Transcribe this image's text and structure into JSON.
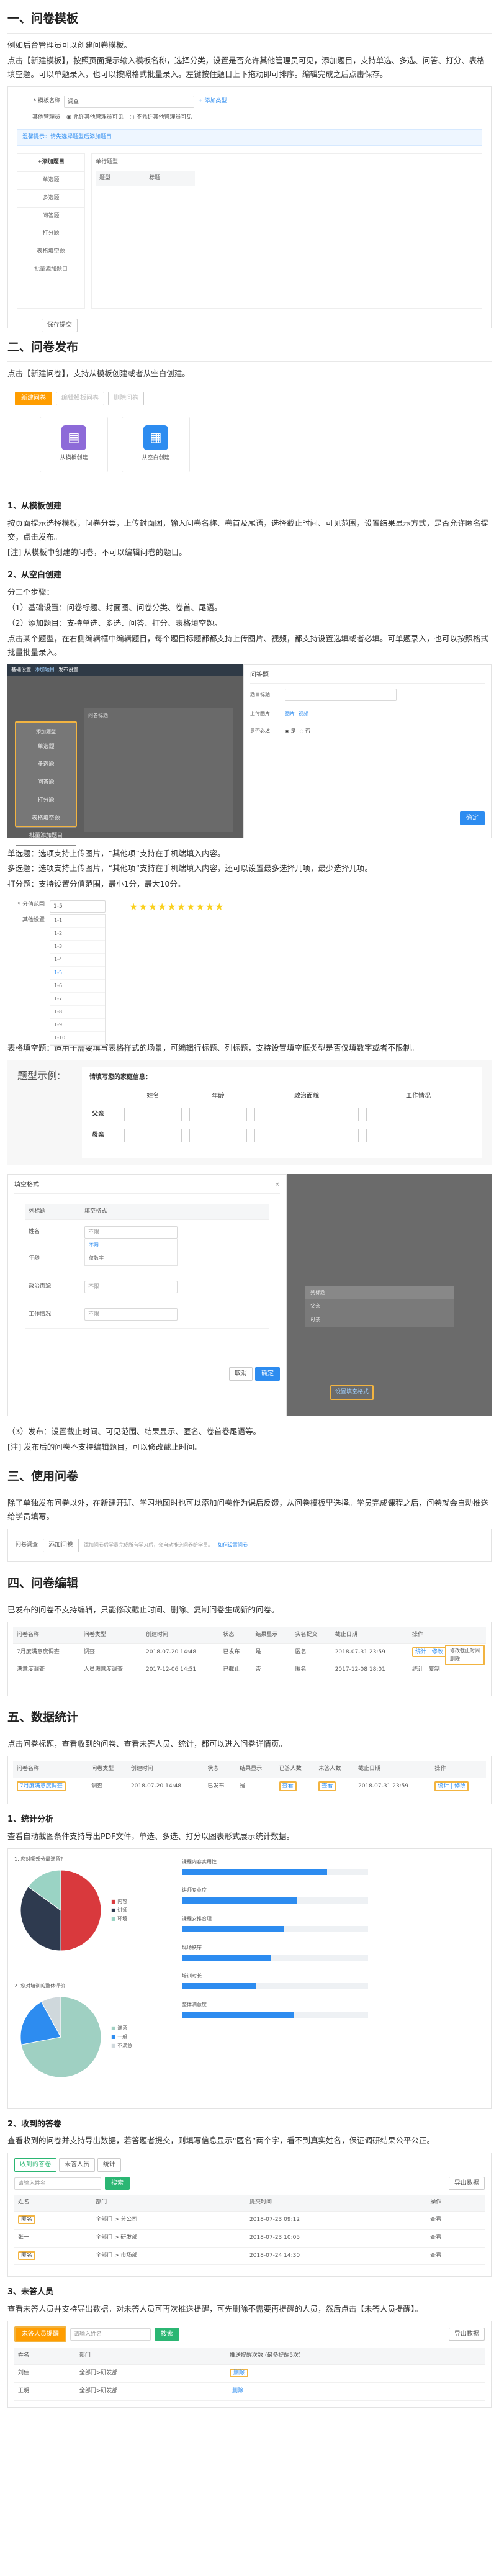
{
  "sec1": {
    "title": "一、问卷模板",
    "intro": "例如后台管理员可以创建问卷模板。",
    "desc": "点击【新建模板】，按照页面提示输入模板名称，选择分类，设置是否允许其他管理员可见，添加题目，支持单选、多选、问答、打分、表格填空题。可以单题录入，也可以按照格式批量录入。左键按住题目上下拖动即可排序。编辑完成之后点击保存。",
    "shot": {
      "name_label": "* 模板名称",
      "name_value": "调查",
      "add_category": "+ 添加类型",
      "visible_label": "其他管理员",
      "opt_allow": "允许其他管理员可见",
      "opt_disallow": "不允许其他管理员可见",
      "tip": "温馨提示：请先选择题型后添加题目",
      "add_question": "+添加题目",
      "question_types": [
        "单选题",
        "多选题",
        "问答题",
        "打分题",
        "表格填空题"
      ],
      "batch_add": "批量添加题目",
      "q_type_label": "单行题型",
      "col_type": "题型",
      "col_title": "标题",
      "save": "保存提交"
    }
  },
  "sec2": {
    "title": "二、问卷发布",
    "desc": "点击【新建问卷】，支持从模板创建或者从空白创建。",
    "shot": {
      "btn_new": "新建问卷",
      "btn_tpl": "编辑模板问卷",
      "btn_del": "删除问卷",
      "card_tpl": "从模板创建",
      "card_blank": "从空白创建"
    },
    "sub1_title": "1、从模板创建",
    "sub1_desc": "按页面提示选择模板，问卷分类，上传封面图，输入问卷名称、卷首及尾语，选择截止时间、可见范围，设置结果显示方式，是否允许匿名提交，点击发布。",
    "sub1_note": "[注] 从模板中创建的问卷，不可以编辑问卷的题目。",
    "sub2_title": "2、从空白创建",
    "sub2_intro": "分三个步骤：",
    "sub2_step1": "（1）基础设置：问卷标题、封面图、问卷分类、卷首、尾语。",
    "sub2_step2": "（2）添加题目：支持单选、多选、问答、打分、表格填空题。",
    "sub2_desc": "点击某个题型，在右侧编辑框中编辑题目，每个题目标题都都支持上传图片、视频，都支持设置选填或者必填。可单题录入，也可以按照格式批量批量录入。",
    "editor": {
      "tab_basic": "基础设置",
      "tab_questions": "添加题目",
      "tab_publish": "发布设置",
      "sidebar_title": "添加题型",
      "types": [
        "单选题",
        "多选题",
        "问答题",
        "打分题",
        "表格填空题",
        "批量添加题目"
      ],
      "q_placeholder": "问卷标题",
      "panel_title": "问答题",
      "field_title": "题目标题",
      "field_upload": "上传图片",
      "field_image": "图片",
      "field_video": "视频",
      "field_required": "是否必填",
      "opt_yes": "是",
      "opt_no": "否",
      "confirm": "确定"
    },
    "single": "单选题：选项支持上传图片，“其他项”支持在手机端填入内容。",
    "multiple": "多选题：选项支持上传图片，“其他项”支持在手机端填入内容，还可以设置最多选择几项，最少选择几项。",
    "score": "打分题：支持设置分值范围，最小1分，最大10分。",
    "score_shot": {
      "range_label": "* 分值范围",
      "range_value": "1-5",
      "max_label": "其他设置",
      "options": [
        "1-1",
        "1-2",
        "1-3",
        "1-4",
        "1-5",
        "1-6",
        "1-7",
        "1-8",
        "1-9",
        "1-10"
      ],
      "stars": "★★★★★★★★★★"
    },
    "table": "表格填空题：适用于需要填写表格样式的场景，可编辑行标题、列标题，支持设置填空框类型是否仅填数字或者不限制。",
    "table_example": {
      "caption": "题型示例:",
      "question": "请填写您的家庭信息：",
      "cols": [
        "姓名",
        "年龄",
        "政治面貌",
        "工作情况"
      ],
      "rows": [
        "父亲",
        "母亲"
      ]
    },
    "fill_dialog": {
      "title": "填空格式",
      "col_head": "列标题",
      "col_fmt": "填空格式",
      "rows": [
        "姓名",
        "年龄",
        "政治面貌",
        "工作情况"
      ],
      "values": [
        "不限",
        "不限",
        "不限",
        "不限"
      ],
      "dd_opts": [
        "不限",
        "仅数字"
      ],
      "cancel": "取消",
      "confirm": "确定",
      "side_cols": [
        "列标题",
        "父亲",
        "母亲"
      ],
      "side_link": "设置填空格式"
    },
    "sub3": "（3）发布：设置截止时间、可见范围、结果显示、匿名、卷首卷尾语等。",
    "sub3_note": "[注] 发布后的问卷不支持编辑题目，可以修改截止时间。"
  },
  "sec3": {
    "title": "三、使用问卷",
    "desc": "除了单独发布问卷以外，在新建开班、学习地图时也可以添加问卷作为课后反馈，从问卷模板里选择。学员完成课程之后，问卷就会自动推送给学员填写。",
    "shot": {
      "label": "问卷调查",
      "btn": "添加问卷",
      "tip": "添加问卷后学员完成所有学习后，会自动推送问卷给学员。",
      "link": "如何设置问卷"
    }
  },
  "sec4": {
    "title": "四、问卷编辑",
    "desc": "已发布的问卷不支持编辑，只能修改截止时间、删除、复制问卷生成新的问卷。",
    "table": {
      "headers": [
        "问卷名称",
        "问卷类型",
        "创建时间",
        "状态",
        "结果显示",
        "实名提交",
        "截止日期",
        "操作"
      ],
      "rows": [
        [
          "7月度满意度调查",
          "调查",
          "2018-07-20 14:48",
          "已发布",
          "是",
          "匿名",
          "2018-07-31 23:59",
          "统计 | 修改 | 复制"
        ],
        [
          "满意度调查",
          "人员满意度调查",
          "2017-12-06 14:51",
          "已截止",
          "否",
          "匿名",
          "2017-12-08 18:01",
          "统计 | 复制"
        ]
      ],
      "popup": [
        "修改截止时间",
        "删除"
      ]
    }
  },
  "sec5": {
    "title": "五、数据统计",
    "desc": "点击问卷标题，查看收到的问卷、查看未答人员、统计，都可以进入问卷详情页。",
    "table": {
      "headers": [
        "问卷名称",
        "问卷类型",
        "创建时间",
        "状态",
        "结果显示",
        "已答人数",
        "未答人数",
        "截止日期",
        "操作"
      ],
      "row": [
        "7月度满意度调查",
        "调查",
        "2018-07-20 14:48",
        "已发布",
        "是",
        "查看",
        "查看",
        "2018-07-31 23:59",
        "统计 | 修改"
      ]
    },
    "sub1_title": "1、统计分析",
    "sub1_desc": "查看自动截图条件支持导出PDF文件，单选、多选、打分以图表形式展示统计数据。",
    "pie1": {
      "label": "1. 您对哪部分最满意？",
      "legend": [
        "内容",
        "讲师",
        "环境"
      ],
      "values": [
        50,
        35,
        15
      ],
      "colors": [
        "#d9393d",
        "#2e3a4f",
        "#9ad3c4"
      ]
    },
    "pie2": {
      "label": "2. 您对培训的整体评价",
      "legend": [
        "满意",
        "一般",
        "不满意"
      ],
      "values": [
        72,
        20,
        8
      ],
      "colors": [
        "#9fd0c2",
        "#2d8cf0",
        "#cfd8dc"
      ]
    },
    "bars1": {
      "items": [
        "课程内容实用性",
        "讲师专业度",
        "课程安排合理",
        "现场秩序",
        "培训时长",
        "整体满意度"
      ],
      "values": [
        0.78,
        0.62,
        0.55,
        0.48,
        0.4,
        0.6
      ]
    },
    "sub2_title": "2、收到的答卷",
    "sub2_desc": "查看收到的问卷并支持导出数据，若答题者提交，则填写信息显示“匿名”两个字，看不到真实姓名，保证调研结果公平公正。",
    "recv": {
      "tabs": [
        "收到的答卷",
        "未答人员",
        "统计"
      ],
      "search_placeholder": "请输入姓名",
      "search_btn": "搜索",
      "export": "导出数据",
      "headers": [
        "姓名",
        "部门",
        "提交时间",
        "操作"
      ],
      "rows": [
        [
          "匿名",
          "全部门 > 分公司",
          "2018-07-23 09:12",
          "查看"
        ],
        [
          "张一",
          "全部门 > 研发部",
          "2018-07-23 10:05",
          "查看"
        ],
        [
          "匿名",
          "全部门 > 市场部",
          "2018-07-24 14:30",
          "查看"
        ]
      ]
    },
    "sub3_title": "3、未答人员",
    "sub3_desc": "查看未答人员并支持导出数据。对未答人员可再次推送提醒，可先删除不需要再提醒的人员，然后点击【未答人员提醒】。",
    "unans": {
      "btn_remind": "未答人员提醒",
      "search_placeholder": "请输入姓名",
      "search_btn": "搜索",
      "export": "导出数据",
      "headers": [
        "姓名",
        "部门",
        "推送提醒次数 (最多提醒5次)"
      ],
      "rows": [
        [
          "刘佳",
          "全部门>研发部",
          "删除"
        ],
        [
          "王明",
          "全部门>研发部",
          "删除"
        ]
      ]
    }
  }
}
